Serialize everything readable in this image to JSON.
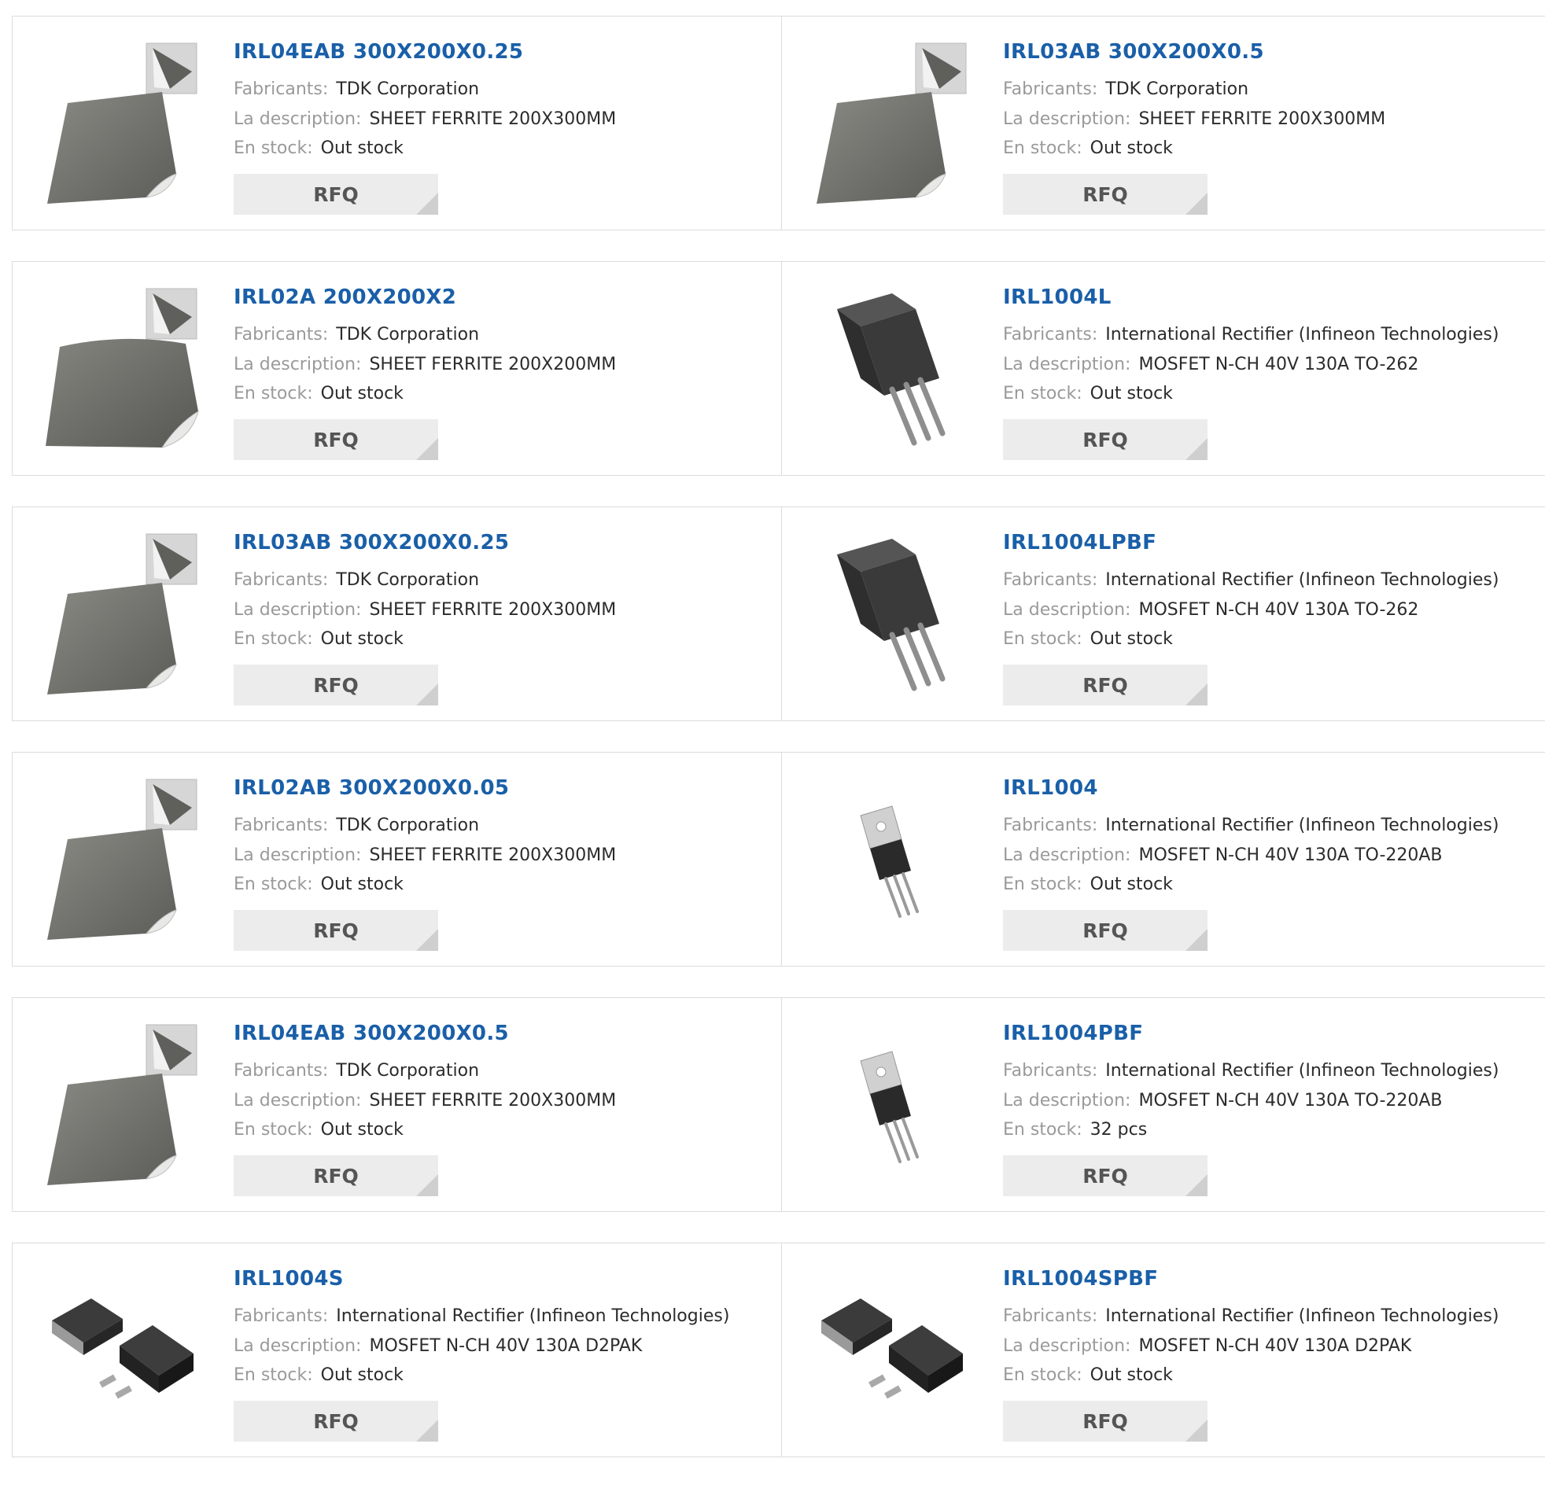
{
  "labels": {
    "manufacturer": "Fabricants:",
    "description": "La description:",
    "stock": "En stock:",
    "rfq": "RFQ"
  },
  "products": [
    {
      "title": "IRL04EAB 300X200X0.25",
      "manufacturer": "TDK Corporation",
      "description": "SHEET FERRITE 200X300MM",
      "stock": "Out stock",
      "image": "ferrite-sheet"
    },
    {
      "title": "IRL03AB 300X200X0.5",
      "manufacturer": "TDK Corporation",
      "description": "SHEET FERRITE 200X300MM",
      "stock": "Out stock",
      "image": "ferrite-sheet"
    },
    {
      "title": "IRL02A 200X200X2",
      "manufacturer": "TDK Corporation",
      "description": "SHEET FERRITE 200X200MM",
      "stock": "Out stock",
      "image": "ferrite-sheet-square"
    },
    {
      "title": "IRL1004L",
      "manufacturer": "International Rectifier (Infineon Technologies)",
      "description": "MOSFET N-CH 40V 130A TO-262",
      "stock": "Out stock",
      "image": "to262-transistor"
    },
    {
      "title": "IRL03AB 300X200X0.25",
      "manufacturer": "TDK Corporation",
      "description": "SHEET FERRITE 200X300MM",
      "stock": "Out stock",
      "image": "ferrite-sheet"
    },
    {
      "title": "IRL1004LPBF",
      "manufacturer": "International Rectifier (Infineon Technologies)",
      "description": "MOSFET N-CH 40V 130A TO-262",
      "stock": "Out stock",
      "image": "to262-transistor"
    },
    {
      "title": "IRL02AB 300X200X0.05",
      "manufacturer": "TDK Corporation",
      "description": "SHEET FERRITE 200X300MM",
      "stock": "Out stock",
      "image": "ferrite-sheet"
    },
    {
      "title": "IRL1004",
      "manufacturer": "International Rectifier (Infineon Technologies)",
      "description": "MOSFET N-CH 40V 130A TO-220AB",
      "stock": "Out stock",
      "image": "to220-transistor"
    },
    {
      "title": "IRL04EAB 300X200X0.5",
      "manufacturer": "TDK Corporation",
      "description": "SHEET FERRITE 200X300MM",
      "stock": "Out stock",
      "image": "ferrite-sheet"
    },
    {
      "title": "IRL1004PBF",
      "manufacturer": "International Rectifier (Infineon Technologies)",
      "description": "MOSFET N-CH 40V 130A TO-220AB",
      "stock": "32 pcs",
      "image": "to220-transistor"
    },
    {
      "title": "IRL1004S",
      "manufacturer": "International Rectifier (Infineon Technologies)",
      "description": "MOSFET N-CH 40V 130A D2PAK",
      "stock": "Out stock",
      "image": "d2pak-transistor"
    },
    {
      "title": "IRL1004SPBF",
      "manufacturer": "International Rectifier (Infineon Technologies)",
      "description": "MOSFET N-CH 40V 130A D2PAK",
      "stock": "Out stock",
      "image": "d2pak-transistor"
    }
  ]
}
